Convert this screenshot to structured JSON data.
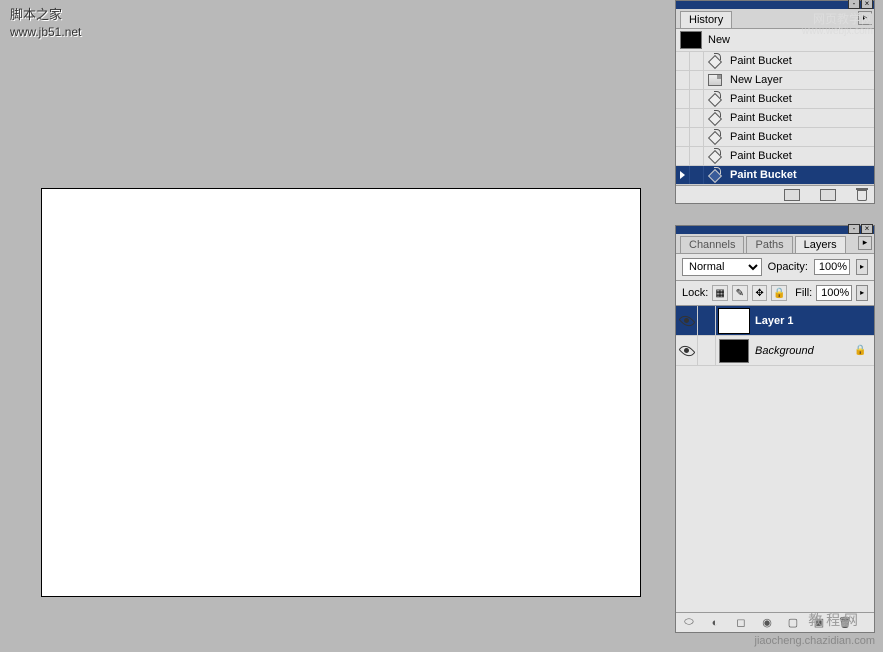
{
  "watermarks": {
    "top_text": "脚本之家",
    "top_url": "www.jb51.net",
    "right_text": "网页教学网",
    "right_url": "www.webjx.com",
    "bottom_faded": "教  程  网",
    "bottom_url": "jiaocheng.chazidian.com"
  },
  "history_panel": {
    "tab_label": "History",
    "thumb_label": "New",
    "items": [
      {
        "label": "Paint Bucket",
        "icon": "bucket",
        "active": false
      },
      {
        "label": "New Layer",
        "icon": "newlayer",
        "active": false
      },
      {
        "label": "Paint Bucket",
        "icon": "bucket",
        "active": false
      },
      {
        "label": "Paint Bucket",
        "icon": "bucket",
        "active": false
      },
      {
        "label": "Paint Bucket",
        "icon": "bucket",
        "active": false
      },
      {
        "label": "Paint Bucket",
        "icon": "bucket",
        "active": false
      },
      {
        "label": "Paint Bucket",
        "icon": "bucket",
        "active": true
      }
    ]
  },
  "layers_panel": {
    "tabs": {
      "channels": "Channels",
      "paths": "Paths",
      "layers": "Layers"
    },
    "blend_mode": "Normal",
    "opacity_label": "Opacity:",
    "opacity_value": "100%",
    "lock_label": "Lock:",
    "fill_label": "Fill:",
    "fill_value": "100%",
    "layers": [
      {
        "name": "Layer 1",
        "thumb": "white",
        "active": true,
        "locked": false,
        "visible": true
      },
      {
        "name": "Background",
        "thumb": "black",
        "active": false,
        "locked": true,
        "visible": true
      }
    ]
  }
}
